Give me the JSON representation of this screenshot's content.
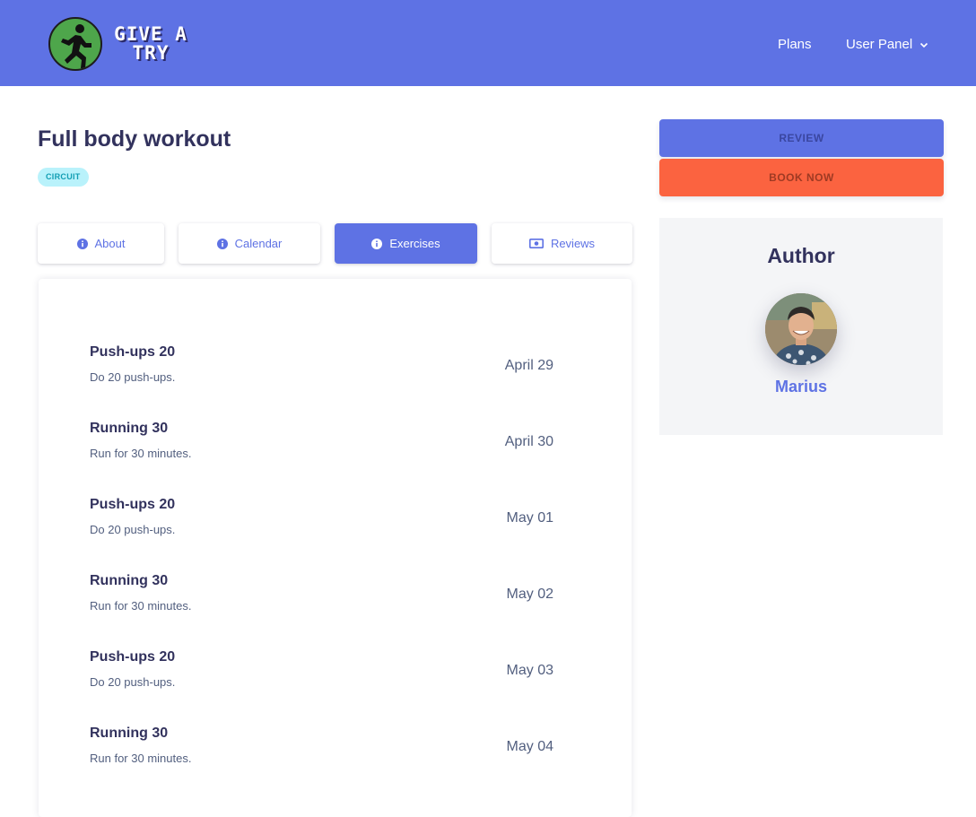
{
  "brand": {
    "line1": "GIVE A",
    "line2": "TRY"
  },
  "nav": {
    "plans": "Plans",
    "user_panel": "User Panel"
  },
  "workout": {
    "title": "Full body workout",
    "badge": "CIRCUIT"
  },
  "tabs": [
    {
      "label": "About",
      "icon": "info-circle-icon",
      "active": false
    },
    {
      "label": "Calendar",
      "icon": "info-circle-icon",
      "active": false
    },
    {
      "label": "Exercises",
      "icon": "info-circle-icon",
      "active": true
    },
    {
      "label": "Reviews",
      "icon": "money-bill-icon",
      "active": false
    }
  ],
  "exercises": [
    {
      "name": "Push-ups 20",
      "desc": "Do 20 push-ups.",
      "date": "April 29"
    },
    {
      "name": "Running 30",
      "desc": "Run for 30 minutes.",
      "date": "April 30"
    },
    {
      "name": "Push-ups 20",
      "desc": "Do 20 push-ups.",
      "date": "May 01"
    },
    {
      "name": "Running 30",
      "desc": "Run for 30 minutes.",
      "date": "May 02"
    },
    {
      "name": "Push-ups 20",
      "desc": "Do 20 push-ups.",
      "date": "May 03"
    },
    {
      "name": "Running 30",
      "desc": "Run for 30 minutes.",
      "date": "May 04"
    }
  ],
  "actions": {
    "review": "REVIEW",
    "book": "BOOK NOW"
  },
  "author": {
    "title": "Author",
    "name": "Marius"
  },
  "colors": {
    "primary": "#5e72e4",
    "orange": "#fb6340",
    "heading": "#32325d",
    "badge_bg": "#b9f2fb"
  }
}
